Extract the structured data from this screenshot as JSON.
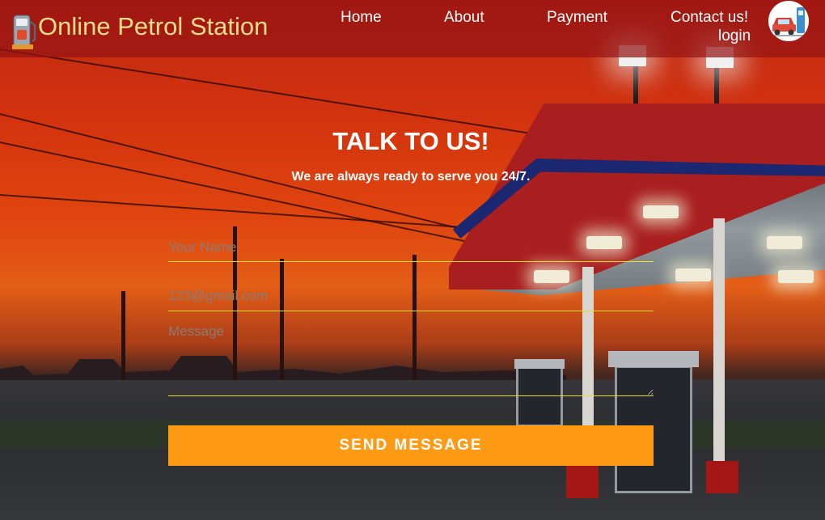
{
  "header": {
    "brand": "Online Petrol Station",
    "logo_icon": "fuel-pump-icon",
    "nav": {
      "home": "Home",
      "about": "About",
      "payment": "Payment",
      "contact": "Contact us!",
      "login": "login"
    },
    "avatar_icon": "car-at-pump-icon"
  },
  "contact": {
    "title": "TALK TO US!",
    "subtitle": "We are always ready to serve you 24/7.",
    "name_placeholder": "Your Name",
    "email_placeholder": "123@gmail.com",
    "message_placeholder": "Message",
    "submit_label": "SEND MESSAGE"
  },
  "colors": {
    "brand_text": "#f6dc8c",
    "nav_bg": "#961414",
    "field_underline": "#e8df2a",
    "button_bg": "#ff9a14"
  }
}
